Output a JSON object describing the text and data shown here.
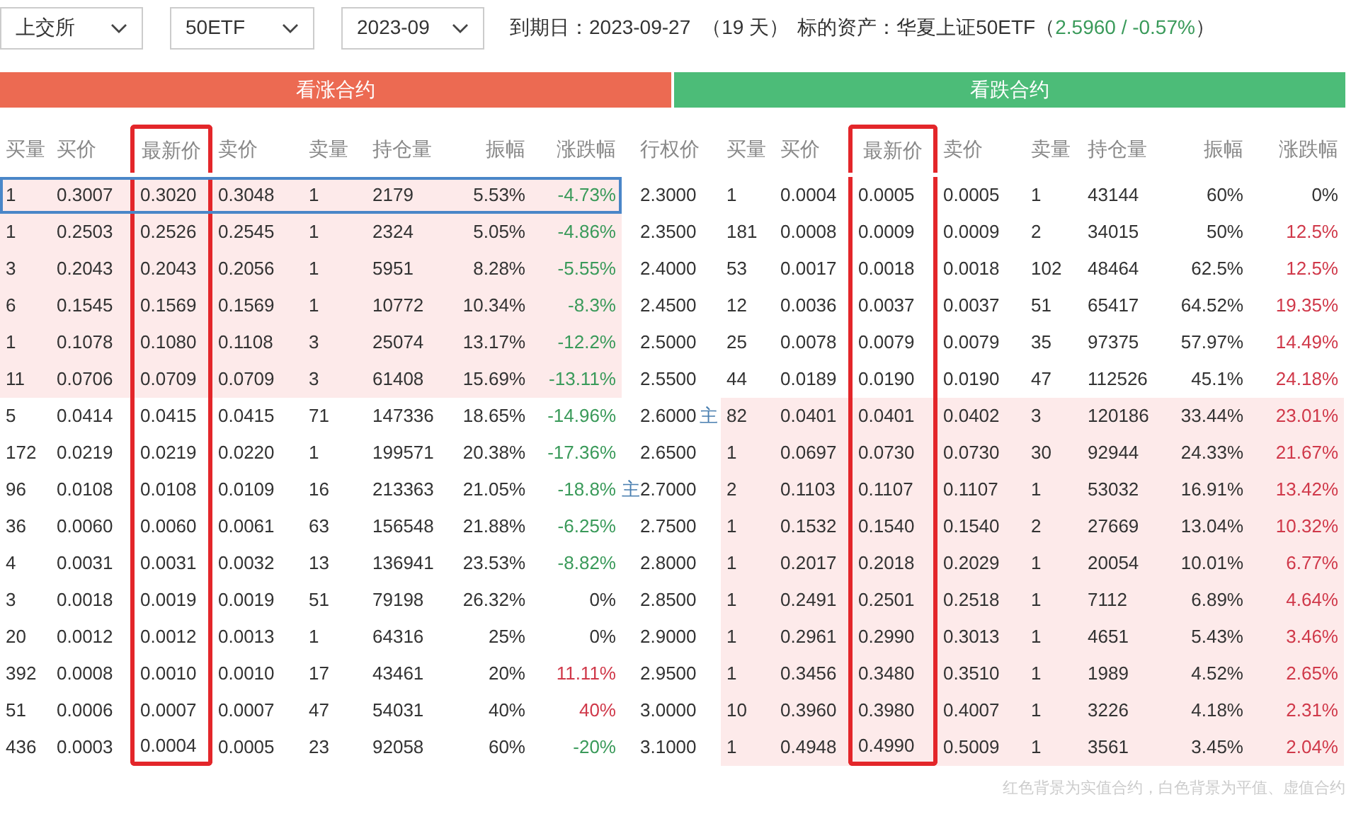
{
  "selectors": [
    {
      "value": "上交所"
    },
    {
      "value": "50ETF"
    },
    {
      "value": "2023-09"
    }
  ],
  "info": {
    "expiry": "到期日：2023-09-27",
    "days": "（19 天）",
    "underlying_label": "标的资产：华夏上证50ETF（",
    "underlying_price": "2.5960 / -0.57%",
    "closing": "）"
  },
  "call_header": "看涨合约",
  "put_header": "看跌合约",
  "call_columns": [
    "买量",
    "买价",
    "最新价",
    "卖价",
    "卖量",
    "持仓量",
    "振幅",
    "涨跌幅"
  ],
  "strike_column": "行权价",
  "put_columns": [
    "买量",
    "买价",
    "最新价",
    "卖价",
    "卖量",
    "持仓量",
    "振幅",
    "涨跌幅"
  ],
  "rows": [
    {
      "strike": "2.3000",
      "selected": true,
      "call": {
        "cells": [
          "1",
          "0.3007",
          "0.3020",
          "0.3048",
          "1",
          "2179",
          "5.53%",
          "-4.73%"
        ],
        "color": "#3a9a5a",
        "itm": true
      },
      "put": {
        "cells": [
          "1",
          "0.0004",
          "0.0005",
          "0.0005",
          "1",
          "43144",
          "60%",
          "0%"
        ],
        "color": "#333333",
        "itm": false
      }
    },
    {
      "strike": "2.3500",
      "selected": false,
      "call": {
        "cells": [
          "1",
          "0.2503",
          "0.2526",
          "0.2545",
          "1",
          "2324",
          "5.05%",
          "-4.86%"
        ],
        "color": "#3a9a5a",
        "itm": true
      },
      "put": {
        "cells": [
          "181",
          "0.0008",
          "0.0009",
          "0.0009",
          "2",
          "34015",
          "50%",
          "12.5%"
        ],
        "color": "#d0394a",
        "itm": false
      }
    },
    {
      "strike": "2.4000",
      "selected": false,
      "call": {
        "cells": [
          "3",
          "0.2043",
          "0.2043",
          "0.2056",
          "1",
          "5951",
          "8.28%",
          "-5.55%"
        ],
        "color": "#3a9a5a",
        "itm": true
      },
      "put": {
        "cells": [
          "53",
          "0.0017",
          "0.0018",
          "0.0018",
          "102",
          "48464",
          "62.5%",
          "12.5%"
        ],
        "color": "#d0394a",
        "itm": false
      }
    },
    {
      "strike": "2.4500",
      "selected": false,
      "call": {
        "cells": [
          "6",
          "0.1545",
          "0.1569",
          "0.1569",
          "1",
          "10772",
          "10.34%",
          "-8.3%"
        ],
        "color": "#3a9a5a",
        "itm": true
      },
      "put": {
        "cells": [
          "12",
          "0.0036",
          "0.0037",
          "0.0037",
          "51",
          "65417",
          "64.52%",
          "19.35%"
        ],
        "color": "#d0394a",
        "itm": false
      }
    },
    {
      "strike": "2.5000",
      "selected": false,
      "call": {
        "cells": [
          "1",
          "0.1078",
          "0.1080",
          "0.1108",
          "3",
          "25074",
          "13.17%",
          "-12.2%"
        ],
        "color": "#3a9a5a",
        "itm": true
      },
      "put": {
        "cells": [
          "25",
          "0.0078",
          "0.0079",
          "0.0079",
          "35",
          "97375",
          "57.97%",
          "14.49%"
        ],
        "color": "#d0394a",
        "itm": false
      }
    },
    {
      "strike": "2.5500",
      "selected": false,
      "call": {
        "cells": [
          "11",
          "0.0706",
          "0.0709",
          "0.0709",
          "3",
          "61408",
          "15.69%",
          "-13.11%"
        ],
        "color": "#3a9a5a",
        "itm": true
      },
      "put": {
        "cells": [
          "44",
          "0.0189",
          "0.0190",
          "0.0190",
          "47",
          "112526",
          "45.1%",
          "24.18%"
        ],
        "color": "#d0394a",
        "itm": false
      }
    },
    {
      "strike": "2.6000",
      "selected": false,
      "marker_right": "主",
      "call": {
        "cells": [
          "5",
          "0.0414",
          "0.0415",
          "0.0415",
          "71",
          "147336",
          "18.65%",
          "-14.96%"
        ],
        "color": "#3a9a5a",
        "itm": false
      },
      "put": {
        "cells": [
          "82",
          "0.0401",
          "0.0401",
          "0.0402",
          "3",
          "120186",
          "33.44%",
          "23.01%"
        ],
        "color": "#d0394a",
        "itm": true
      }
    },
    {
      "strike": "2.6500",
      "selected": false,
      "call": {
        "cells": [
          "172",
          "0.0219",
          "0.0219",
          "0.0220",
          "1",
          "199571",
          "20.38%",
          "-17.36%"
        ],
        "color": "#3a9a5a",
        "itm": false
      },
      "put": {
        "cells": [
          "1",
          "0.0697",
          "0.0730",
          "0.0730",
          "30",
          "92944",
          "24.33%",
          "21.67%"
        ],
        "color": "#d0394a",
        "itm": true
      }
    },
    {
      "strike": "2.7000",
      "selected": false,
      "marker_left": "主",
      "call": {
        "cells": [
          "96",
          "0.0108",
          "0.0108",
          "0.0109",
          "16",
          "213363",
          "21.05%",
          "-18.8%"
        ],
        "color": "#3a9a5a",
        "itm": false
      },
      "put": {
        "cells": [
          "2",
          "0.1103",
          "0.1107",
          "0.1107",
          "1",
          "53032",
          "16.91%",
          "13.42%"
        ],
        "color": "#d0394a",
        "itm": true
      }
    },
    {
      "strike": "2.7500",
      "selected": false,
      "call": {
        "cells": [
          "36",
          "0.0060",
          "0.0060",
          "0.0061",
          "63",
          "156548",
          "21.88%",
          "-6.25%"
        ],
        "color": "#3a9a5a",
        "itm": false
      },
      "put": {
        "cells": [
          "1",
          "0.1532",
          "0.1540",
          "0.1540",
          "2",
          "27669",
          "13.04%",
          "10.32%"
        ],
        "color": "#d0394a",
        "itm": true
      }
    },
    {
      "strike": "2.8000",
      "selected": false,
      "call": {
        "cells": [
          "4",
          "0.0031",
          "0.0031",
          "0.0032",
          "13",
          "136941",
          "23.53%",
          "-8.82%"
        ],
        "color": "#3a9a5a",
        "itm": false
      },
      "put": {
        "cells": [
          "1",
          "0.2017",
          "0.2018",
          "0.2029",
          "1",
          "20054",
          "10.01%",
          "6.77%"
        ],
        "color": "#d0394a",
        "itm": true
      }
    },
    {
      "strike": "2.8500",
      "selected": false,
      "call": {
        "cells": [
          "3",
          "0.0018",
          "0.0019",
          "0.0019",
          "51",
          "79198",
          "26.32%",
          "0%"
        ],
        "color": "#333333",
        "itm": false
      },
      "put": {
        "cells": [
          "1",
          "0.2491",
          "0.2501",
          "0.2518",
          "1",
          "7112",
          "6.89%",
          "4.64%"
        ],
        "color": "#d0394a",
        "itm": true
      }
    },
    {
      "strike": "2.9000",
      "selected": false,
      "call": {
        "cells": [
          "20",
          "0.0012",
          "0.0012",
          "0.0013",
          "1",
          "64316",
          "25%",
          "0%"
        ],
        "color": "#333333",
        "itm": false
      },
      "put": {
        "cells": [
          "1",
          "0.2961",
          "0.2990",
          "0.3013",
          "1",
          "4651",
          "5.43%",
          "3.46%"
        ],
        "color": "#d0394a",
        "itm": true
      }
    },
    {
      "strike": "2.9500",
      "selected": false,
      "call": {
        "cells": [
          "392",
          "0.0008",
          "0.0010",
          "0.0010",
          "17",
          "43461",
          "20%",
          "11.11%"
        ],
        "color": "#d0394a",
        "itm": false
      },
      "put": {
        "cells": [
          "1",
          "0.3456",
          "0.3480",
          "0.3510",
          "1",
          "1989",
          "4.52%",
          "2.65%"
        ],
        "color": "#d0394a",
        "itm": true
      }
    },
    {
      "strike": "3.0000",
      "selected": false,
      "call": {
        "cells": [
          "51",
          "0.0006",
          "0.0007",
          "0.0007",
          "47",
          "54031",
          "40%",
          "40%"
        ],
        "color": "#d0394a",
        "itm": false
      },
      "put": {
        "cells": [
          "10",
          "0.3960",
          "0.3980",
          "0.4007",
          "1",
          "3226",
          "4.18%",
          "2.31%"
        ],
        "color": "#d0394a",
        "itm": true
      }
    },
    {
      "strike": "3.1000",
      "selected": false,
      "call": {
        "cells": [
          "436",
          "0.0003",
          "0.0004",
          "0.0005",
          "23",
          "92058",
          "60%",
          "-20%"
        ],
        "color": "#3a9a5a",
        "itm": false
      },
      "put": {
        "cells": [
          "1",
          "0.4948",
          "0.4990",
          "0.5009",
          "1",
          "3561",
          "3.45%",
          "2.04%"
        ],
        "color": "#d0394a",
        "itm": true
      }
    }
  ],
  "footnote": "红色背景为实值合约，白色背景为平值、虚值合约"
}
